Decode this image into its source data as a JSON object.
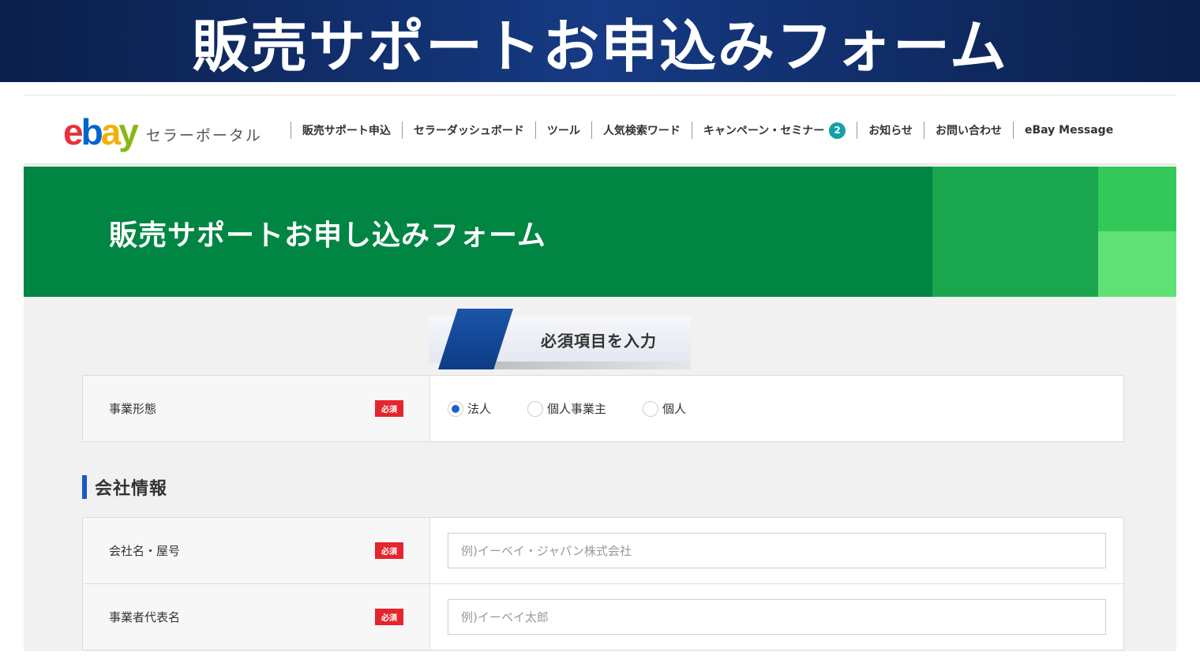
{
  "banner": {
    "title": "販売サポートお申込みフォーム"
  },
  "portal": {
    "logo_letters": {
      "e": "e",
      "b": "b",
      "a": "a",
      "y": "y"
    },
    "name": "セラーポータル",
    "nav": [
      {
        "label": "販売サポート申込"
      },
      {
        "label": "セラーダッシュボード"
      },
      {
        "label": "ツール"
      },
      {
        "label": "人気検索ワード"
      },
      {
        "label": "キャンペーン・セミナー",
        "badge": "2"
      },
      {
        "label": "お知らせ"
      },
      {
        "label": "お問い合わせ"
      },
      {
        "label": "eBay Message"
      }
    ]
  },
  "hero": {
    "title": "販売サポートお申し込みフォーム"
  },
  "step": {
    "label": "必須項目を入力"
  },
  "form": {
    "required_label": "必須",
    "business_type": {
      "label": "事業形態",
      "options": [
        "法人",
        "個人事業主",
        "個人"
      ],
      "selected": "法人"
    },
    "company_section": {
      "title": "会社情報"
    },
    "company_name": {
      "label": "会社名・屋号",
      "placeholder": "例)イーベイ・ジャパン株式会社"
    },
    "representative": {
      "label": "事業者代表名",
      "placeholder": "例)イーベイ太郎"
    }
  },
  "colors": {
    "banner": "#163a84",
    "hero_green": "#008543",
    "accent_blue": "#1858c9",
    "required_red": "#e3262e",
    "badge_teal": "#13a0a8"
  }
}
